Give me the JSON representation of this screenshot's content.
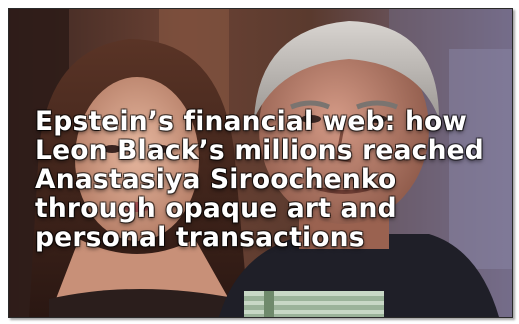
{
  "headline": "Epstein’s financial web: how Leon Black’s millions reached Anastasiya Siroochenko through opaque art and personal transactions",
  "colors": {
    "headline_text": "#ffffff",
    "frame_border": "#2a2a2a",
    "background": "#ffffff"
  }
}
